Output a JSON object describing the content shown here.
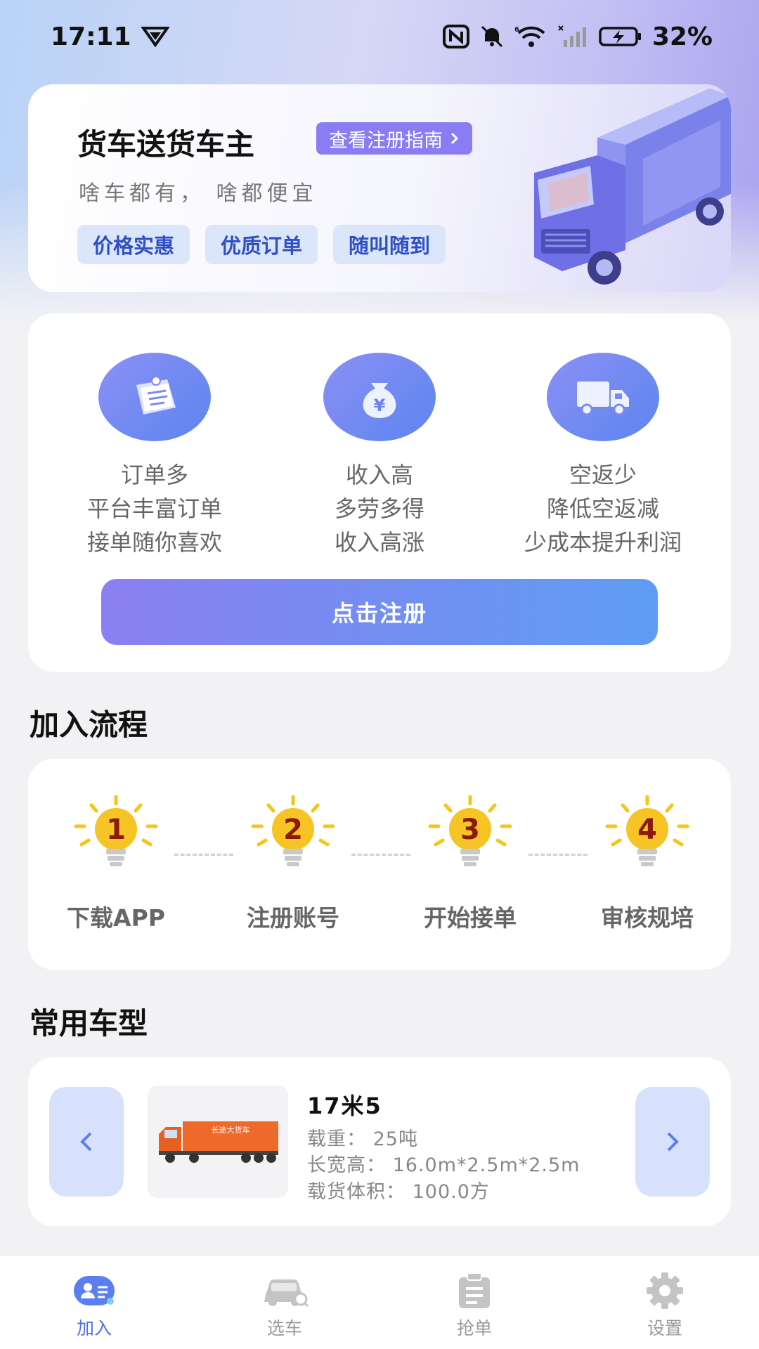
{
  "status_bar": {
    "time": "17:11",
    "battery": "32%"
  },
  "hero": {
    "title": "货车送货车主",
    "guide_label": "查看注册指南",
    "subtitle": "啥车都有，  啥都便宜",
    "tags": [
      "价格实惠",
      "优质订单",
      "随叫随到"
    ]
  },
  "benefits": [
    {
      "icon": "order-docs-icon",
      "title": "订单多",
      "line1": "平台丰富订单",
      "line2": "接单随你喜欢"
    },
    {
      "icon": "money-bag-icon",
      "title": "收入高",
      "line1": "多劳多得",
      "line2": "收入高涨"
    },
    {
      "icon": "truck-icon",
      "title": "空返少",
      "line1": "降低空返减",
      "line2": "少成本提升利润"
    }
  ],
  "register_button": "点击注册",
  "process": {
    "title": "加入流程",
    "steps": [
      {
        "num": "1",
        "label": "下载APP"
      },
      {
        "num": "2",
        "label": "注册账号"
      },
      {
        "num": "3",
        "label": "开始接单"
      },
      {
        "num": "4",
        "label": "审核规培"
      }
    ]
  },
  "vehicles": {
    "title": "常用车型",
    "current": {
      "name": "17米5",
      "load": "载重：  25吨",
      "dimensions": "长宽高：  16.0m*2.5m*2.5m",
      "volume": "载货体积：  100.0方",
      "truck_text": "长途大货车"
    }
  },
  "bottom_nav": [
    {
      "icon": "join-icon",
      "label": "加入",
      "active": true
    },
    {
      "icon": "car-icon",
      "label": "选车",
      "active": false
    },
    {
      "icon": "clipboard-icon",
      "label": "抢单",
      "active": false
    },
    {
      "icon": "gear-icon",
      "label": "设置",
      "active": false
    }
  ],
  "colors": {
    "accent": "#5b7ff0",
    "active_nav": "#4f6fe8",
    "bulb": "#f5c518"
  }
}
